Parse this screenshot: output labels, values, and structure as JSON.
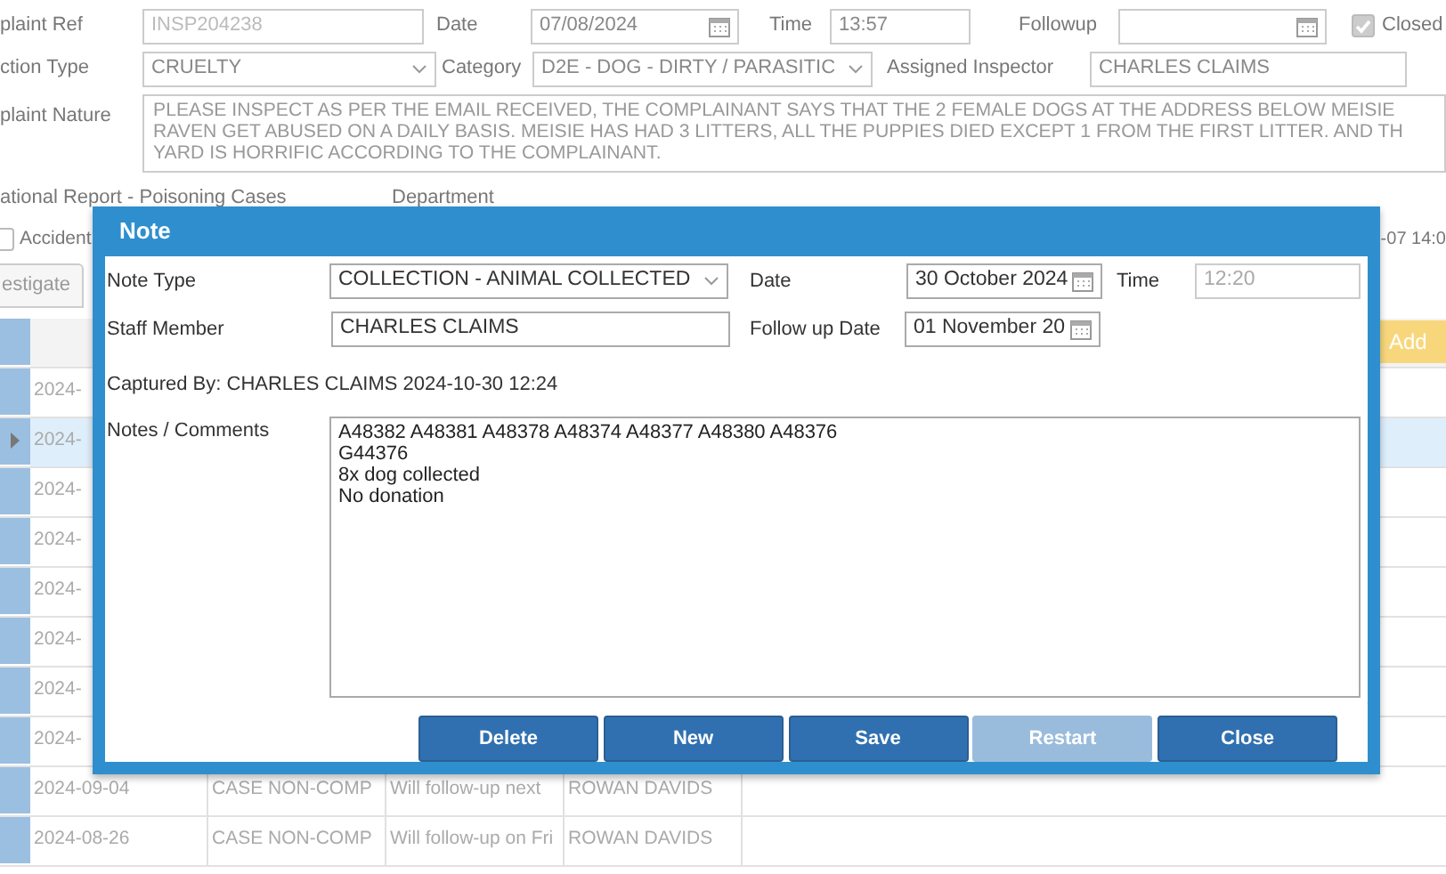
{
  "background_form": {
    "complaint_ref": {
      "label": "plaint Ref",
      "value": "INSP204238",
      "disabled": true
    },
    "date": {
      "label": "Date",
      "value": "07/08/2024"
    },
    "time": {
      "label": "Time",
      "value": "13:57"
    },
    "followup": {
      "label": "Followup"
    },
    "closed": {
      "label": "Closed",
      "checked": true
    },
    "inspection_type": {
      "label": "ction Type",
      "value": "CRUELTY"
    },
    "category": {
      "label": "Category",
      "value": "D2E - DOG - DIRTY / PARASITIC"
    },
    "assigned_inspector": {
      "label": "Assigned Inspector",
      "value": "CHARLES CLAIMS"
    },
    "complaint_nature": {
      "label": "plaint Nature",
      "value": "PLEASE INSPECT AS PER THE EMAIL RECEIVED, THE COMPLAINANT SAYS THAT THE 2 FEMALE DOGS AT THE ADDRESS BELOW MEISIE\nRAVEN GET ABUSED ON A DAILY BASIS. MEISIE HAS HAD 3 LITTERS, ALL THE PUPPIES DIED EXCEPT 1 FROM THE FIRST LITTER. AND TH\nYARD IS HORRIFIC ACCORDING TO THE COMPLAINANT."
    },
    "report_label": "ational Report - Poisoning Cases",
    "department_label": "Department",
    "accident": {
      "label": "Accident",
      "checked": false
    },
    "timestamp": "-07 14:0",
    "tabs": [
      {
        "label": "estigate",
        "selected": false
      }
    ],
    "add_button": "Add"
  },
  "grid": {
    "rows": [
      {
        "cells": [
          "2024-"
        ],
        "selected": false
      },
      {
        "cells": [
          "2024-"
        ],
        "selected": true
      },
      {
        "cells": [
          "2024-"
        ],
        "selected": false
      },
      {
        "cells": [
          "2024-"
        ],
        "selected": false
      },
      {
        "cells": [
          "2024-"
        ],
        "selected": false
      },
      {
        "cells": [
          "2024-"
        ],
        "selected": false
      },
      {
        "cells": [
          "2024-"
        ],
        "selected": false
      },
      {
        "cells": [
          "2024-"
        ],
        "selected": false
      },
      {
        "cells": [
          "2024-09-04",
          "CASE NON-COMP",
          "Will follow-up next",
          "ROWAN DAVIDS"
        ],
        "selected": false
      },
      {
        "cells": [
          "2024-08-26",
          "CASE NON-COMP",
          "Will follow-up on Fri",
          "ROWAN DAVIDS"
        ],
        "selected": false
      }
    ]
  },
  "note_dialog": {
    "title": "Note",
    "note_type": {
      "label": "Note Type",
      "value": "COLLECTION - ANIMAL COLLECTED"
    },
    "date": {
      "label": "Date",
      "value": "30 October 2024"
    },
    "time": {
      "label": "Time",
      "value": "12:20",
      "disabled": true
    },
    "staff_member": {
      "label": "Staff Member",
      "value": "CHARLES CLAIMS"
    },
    "follow_up_date": {
      "label": "Follow up Date",
      "value": "01 November 20"
    },
    "captured_by": "Captured By: CHARLES CLAIMS 2024-10-30 12:24",
    "notes": {
      "label": "Notes / Comments",
      "value": "A48382 A48381 A48378 A48374 A48377 A48380 A48376\nG44376\n8x dog collected\nNo donation"
    },
    "buttons": [
      {
        "label": "Delete",
        "disabled": false
      },
      {
        "label": "New",
        "disabled": false
      },
      {
        "label": "Save",
        "disabled": false
      },
      {
        "label": "Restart",
        "disabled": true
      },
      {
        "label": "Close",
        "disabled": false
      }
    ]
  }
}
